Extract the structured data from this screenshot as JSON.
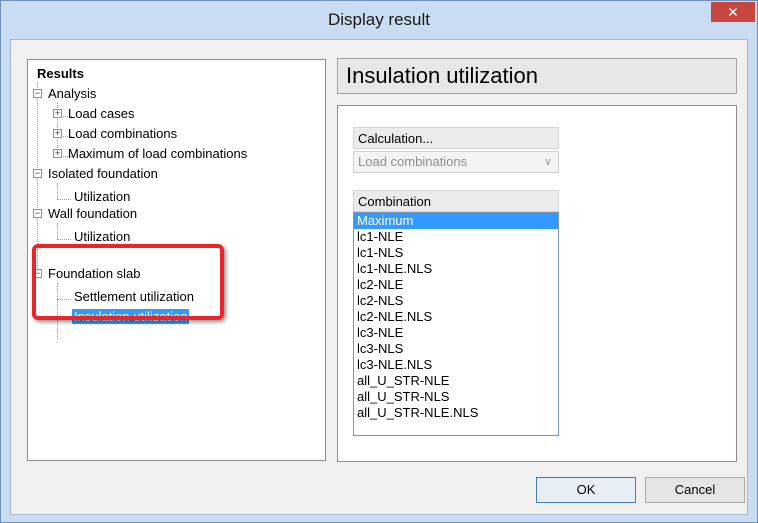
{
  "window": {
    "title": "Display result",
    "close_glyph": "✕"
  },
  "tree": {
    "root": "Results",
    "items": [
      {
        "label": "Analysis",
        "expander": "−"
      },
      {
        "label": "Load cases",
        "expander": "+"
      },
      {
        "label": "Load combinations",
        "expander": "+"
      },
      {
        "label": "Maximum of load combinations",
        "expander": "+"
      },
      {
        "label": "Isolated foundation",
        "expander": "−"
      },
      {
        "label": "Utilization"
      },
      {
        "label": "Wall foundation",
        "expander": "−"
      },
      {
        "label": "Utilization"
      },
      {
        "label": "Foundation slab",
        "expander": "−"
      },
      {
        "label": "Settlement utilization"
      },
      {
        "label": "Insulation utilization",
        "selected": true
      }
    ]
  },
  "panel": {
    "heading": "Insulation utilization",
    "calculation": {
      "label": "Calculation...",
      "value": "Load combinations",
      "arrow": "∨"
    },
    "combination": {
      "label": "Combination",
      "items": [
        "Maximum",
        "lc1-NLE",
        "lc1-NLS",
        "lc1-NLE.NLS",
        "lc2-NLE",
        "lc2-NLS",
        "lc2-NLE.NLS",
        "lc3-NLE",
        "lc3-NLS",
        "lc3-NLE.NLS",
        "all_U_STR-NLE",
        "all_U_STR-NLS",
        "all_U_STR-NLE.NLS"
      ],
      "selected": "Maximum"
    }
  },
  "buttons": {
    "ok": "OK",
    "cancel": "Cancel"
  },
  "colors": {
    "selection": "#3399ff",
    "highlight": "#e8262a",
    "titlebar": "#c9dcf2",
    "close": "#c7463f"
  }
}
